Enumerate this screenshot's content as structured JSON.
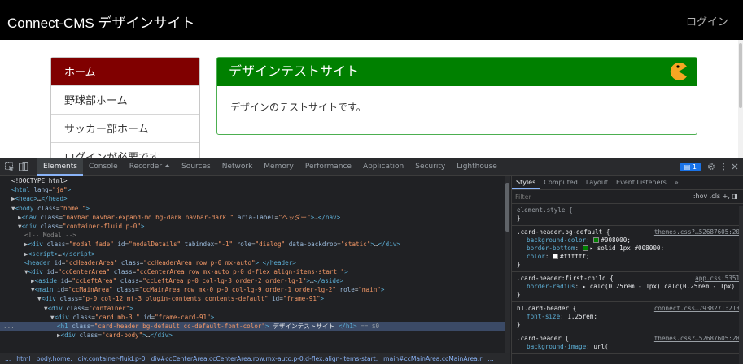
{
  "page": {
    "brand": "Connect-CMS デザインサイト",
    "login": "ログイン",
    "menu": [
      {
        "label": "ホーム",
        "active": true
      },
      {
        "label": "野球部ホーム",
        "active": false
      },
      {
        "label": "サッカー部ホーム",
        "active": false
      },
      {
        "label": "ログインが必要です",
        "active": false
      }
    ],
    "card": {
      "title": "デザインテストサイト",
      "body": "デザインのテストサイトです。"
    }
  },
  "devtools": {
    "tabs": [
      "Elements",
      "Console",
      "Recorder ⏶",
      "Sources",
      "Network",
      "Memory",
      "Performance",
      "Application",
      "Security",
      "Lighthouse"
    ],
    "issues_count": "1",
    "elements_lines": [
      {
        "indent": 0,
        "html": "<span class=\"tx\">&lt;!DOCTYPE html&gt;</span>"
      },
      {
        "indent": 0,
        "html": "<span class=\"tg\">&lt;html</span> <span class=\"at\">lang</span>=<span class=\"av\">\"ja\"</span><span class=\"tg\">&gt;</span>"
      },
      {
        "indent": 0,
        "html": "▶<span class=\"tg\">&lt;head&gt;</span>…<span class=\"tg\">&lt;/head&gt;</span>"
      },
      {
        "indent": 0,
        "html": "▼<span class=\"tg\">&lt;body</span> <span class=\"at\">class</span>=<span class=\"av\">\"home \"</span><span class=\"tg\">&gt;</span>"
      },
      {
        "indent": 1,
        "html": "▶<span class=\"tg\">&lt;nav</span> <span class=\"at\">class</span>=<span class=\"av\">\"navbar navbar-expand-md bg-dark navbar-dark \"</span> <span class=\"at\">aria-label</span>=<span class=\"av\">\"ヘッダー\"</span><span class=\"tg\">&gt;</span>…<span class=\"tg\">&lt;/nav&gt;</span>"
      },
      {
        "indent": 1,
        "html": "▼<span class=\"tg\">&lt;div</span> <span class=\"at\">class</span>=<span class=\"av\">\"container-fluid p-0\"</span><span class=\"tg\">&gt;</span>"
      },
      {
        "indent": 2,
        "html": "<span class=\"cm\">&lt;!-- Modal --&gt;</span>"
      },
      {
        "indent": 2,
        "html": "▶<span class=\"tg\">&lt;div</span> <span class=\"at\">class</span>=<span class=\"av\">\"modal fade\"</span> <span class=\"at\">id</span>=<span class=\"av\">\"modalDetails\"</span> <span class=\"at\">tabindex</span>=<span class=\"av\">\"-1\"</span> <span class=\"at\">role</span>=<span class=\"av\">\"dialog\"</span> <span class=\"at\">data-backdrop</span>=<span class=\"av\">\"static\"</span><span class=\"tg\">&gt;</span>…<span class=\"tg\">&lt;/div&gt;</span>"
      },
      {
        "indent": 2,
        "html": "▶<span class=\"tg\">&lt;script&gt;</span>…<span class=\"tg\">&lt;/script&gt;</span>"
      },
      {
        "indent": 2,
        "html": "<span class=\"tg\">&lt;header</span> <span class=\"at\">id</span>=<span class=\"av\">\"ccHeaderArea\"</span> <span class=\"at\">class</span>=<span class=\"av\">\"ccHeaderArea row p-0 mx-auto\"</span><span class=\"tg\">&gt; &lt;/header&gt;</span>"
      },
      {
        "indent": 2,
        "html": "▼<span class=\"tg\">&lt;div</span> <span class=\"at\">id</span>=<span class=\"av\">\"ccCenterArea\"</span> <span class=\"at\">class</span>=<span class=\"av\">\"ccCenterArea row mx-auto p-0 d-flex align-items-start \"</span><span class=\"tg\">&gt;</span>"
      },
      {
        "indent": 3,
        "html": "▶<span class=\"tg\">&lt;aside</span> <span class=\"at\">id</span>=<span class=\"av\">\"ccLeftArea\"</span> <span class=\"at\">class</span>=<span class=\"av\">\"ccLeftArea p-0 col-lg-3 order-2 order-lg-1\"</span><span class=\"tg\">&gt;</span>…<span class=\"tg\">&lt;/aside&gt;</span>"
      },
      {
        "indent": 3,
        "html": "▼<span class=\"tg\">&lt;main</span> <span class=\"at\">id</span>=<span class=\"av\">\"ccMainArea\"</span> <span class=\"at\">class</span>=<span class=\"av\">\"ccMainArea row mx-0 p-0 col-lg-9 order-1 order-lg-2\"</span> <span class=\"at\">role</span>=<span class=\"av\">\"main\"</span><span class=\"tg\">&gt;</span>"
      },
      {
        "indent": 4,
        "html": "▼<span class=\"tg\">&lt;div</span> <span class=\"at\">class</span>=<span class=\"av\">\"p-0 col-12  mt-3 plugin-contents  contents-default\"</span> <span class=\"at\">id</span>=<span class=\"av\">\"frame-91\"</span><span class=\"tg\">&gt;</span>"
      },
      {
        "indent": 5,
        "html": "▼<span class=\"tg\">&lt;div</span> <span class=\"at\">class</span>=<span class=\"av\">\"container\"</span><span class=\"tg\">&gt;</span>"
      },
      {
        "indent": 6,
        "html": "▼<span class=\"tg\">&lt;div</span> <span class=\"at\">class</span>=<span class=\"av\">\"card mb-3 \"</span> <span class=\"at\">id</span>=<span class=\"av\">\"frame-card-91\"</span><span class=\"tg\">&gt;</span>"
      },
      {
        "indent": 7,
        "sel": true,
        "html": "<span class=\"tg\">&lt;h1</span> <span class=\"at\">class</span>=<span class=\"av\">\"card-header bg-default cc-default-font-color\"</span><span class=\"tg\">&gt;</span> <span class=\"tx\">デザインテストサイト</span> <span class=\"tg\">&lt;/h1&gt;</span> <span class=\"eq\">== $0</span>"
      },
      {
        "indent": 7,
        "html": "▶<span class=\"tg\">&lt;div</span> <span class=\"at\">class</span>=<span class=\"av\">\"card-body\"</span><span class=\"tg\">&gt;</span>…<span class=\"tg\">&lt;/div&gt;</span>"
      }
    ],
    "breadcrumbs": [
      "...",
      "html",
      "body.home.",
      "div.container-fluid.p-0",
      "div#ccCenterArea.ccCenterArea.row.mx-auto.p-0.d-flex.align-items-start.",
      "main#ccMainArea.ccMainArea.r",
      "..."
    ],
    "styles": {
      "tabs": [
        "Styles",
        "Computed",
        "Layout",
        "Event Listeners",
        "»"
      ],
      "filter_placeholder": "Filter",
      "filter_tools": ":hov  .cls  +,  ◨",
      "rules": [
        {
          "selector": "element.style {",
          "source": "",
          "decls": [],
          "close": "}",
          "dim": true
        },
        {
          "selector": ".card-header.bg-default {",
          "source": "themes.css?…52687605:20",
          "decls": [
            {
              "name": "background-color",
              "value": "#008000;",
              "swatch": "#008000"
            },
            {
              "name": "border-bottom",
              "value": "▸ solid 1px  #008000;",
              "swatch": "#008000"
            },
            {
              "name": "color",
              "value": "#ffffff;",
              "swatch": "#ffffff"
            }
          ],
          "close": "}"
        },
        {
          "selector": ".card-header:first-child {",
          "source": "app.css:5351",
          "decls": [
            {
              "name": "border-radius",
              "value": "▸ calc(0.25rem - 1px) calc(0.25rem - 1px) 0 0;",
              "swatch": ""
            }
          ],
          "close": "}"
        },
        {
          "selector": "h1.card-header {",
          "source": "connect.css…7938271:213",
          "decls": [
            {
              "name": "font-size",
              "value": "1.25rem;",
              "swatch": ""
            }
          ],
          "close": "}"
        },
        {
          "selector": ".card-header {",
          "source": "themes.css?…52687605:28",
          "decls": [
            {
              "name": "background-image",
              "value": "url(",
              "swatch": ""
            }
          ],
          "close": ""
        }
      ]
    }
  },
  "colors": {
    "navbar": "#000000",
    "menu_active": "#800000",
    "card_header": "#008000",
    "devtools_bg": "#202124",
    "selection": "#3b4a66"
  }
}
